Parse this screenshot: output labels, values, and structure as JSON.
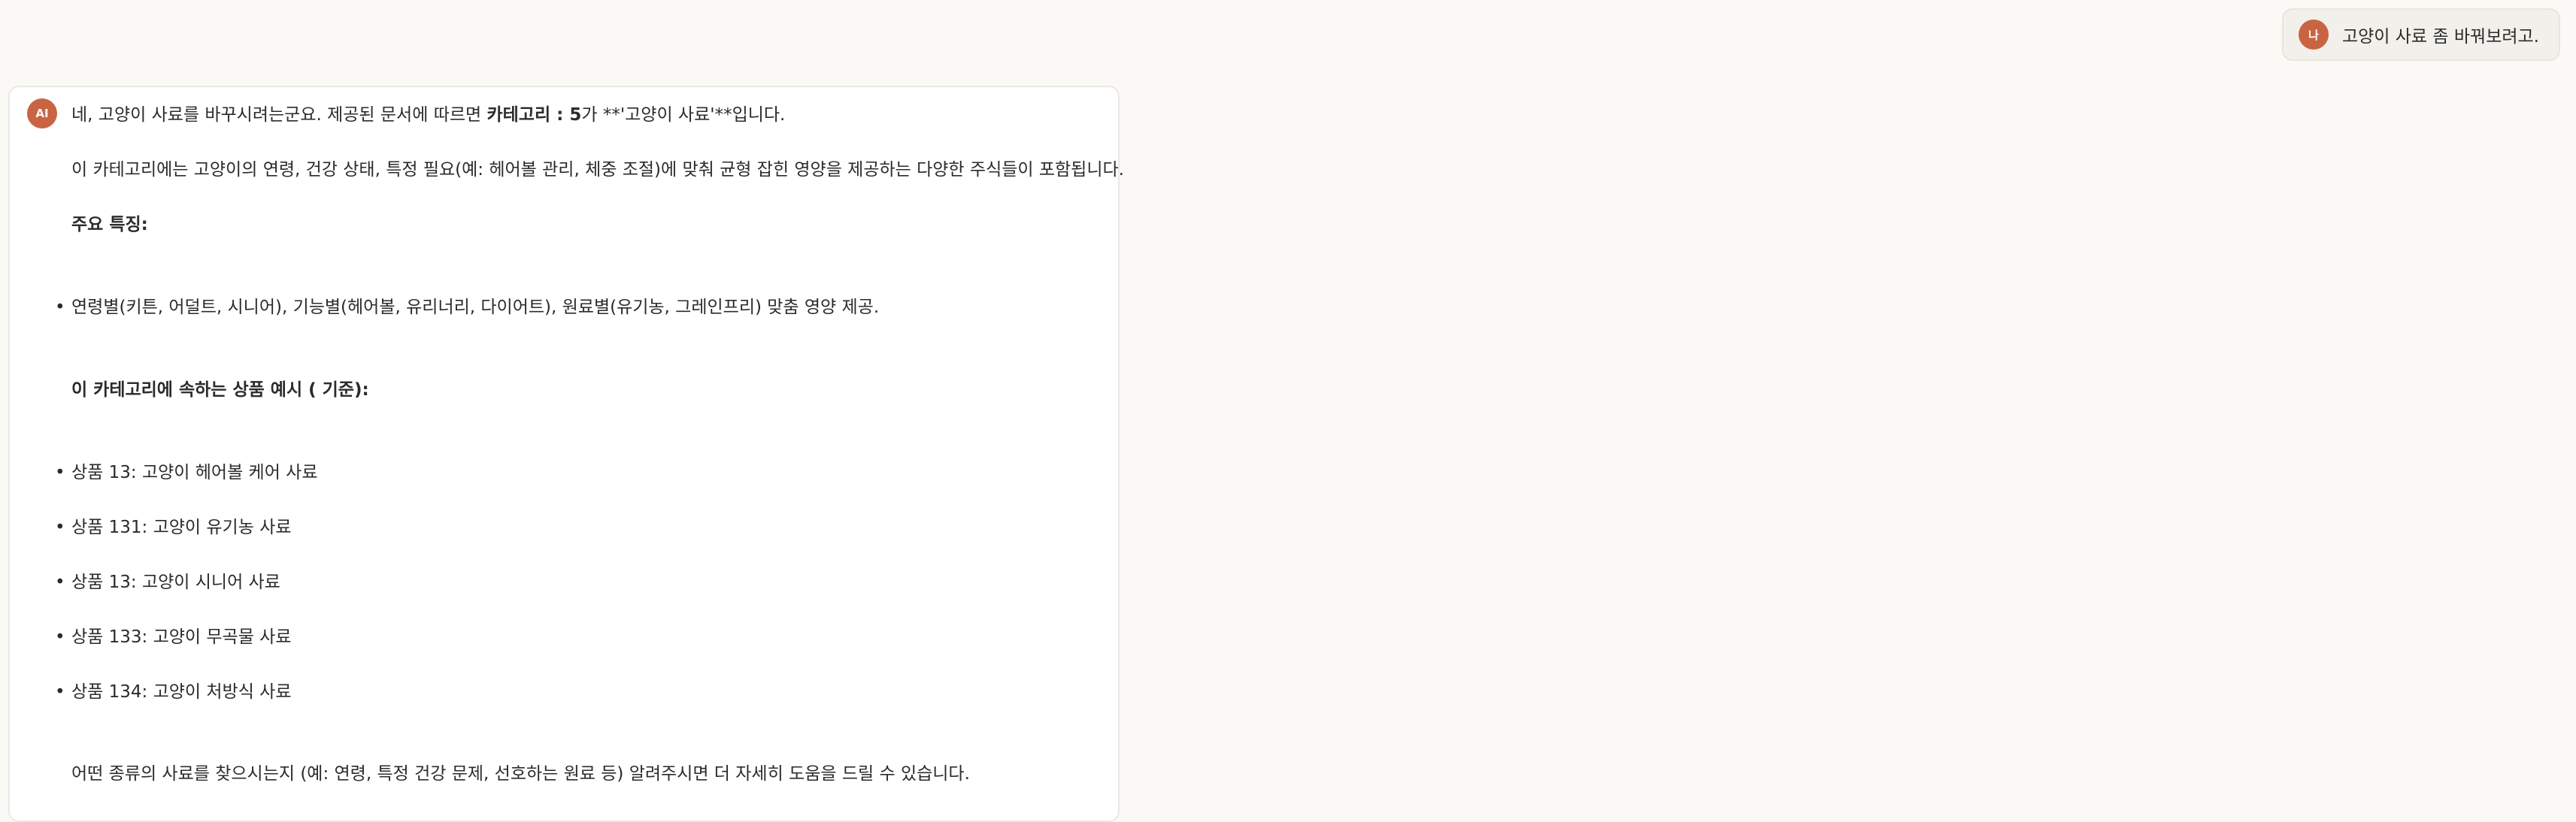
{
  "user_message": {
    "avatar_initial": "나",
    "text": "고양이 사료 좀 바꿔보려고."
  },
  "ai_message": {
    "avatar_label": "AI",
    "intro_prefix": "네, 고양이 사료를 바꾸시려는군요. 제공된 문서에 따르면 ",
    "intro_bold": "카테고리 : 5",
    "intro_suffix": "가 **'고양이 사료'**입니다.",
    "description": "이 카테고리에는 고양이의 연령, 건강 상태, 특정 필요(예: 헤어볼 관리, 체중 조절)에 맞춰 균형 잡힌 영양을 제공하는 다양한 주식들이 포함됩니다.",
    "features_heading": "주요 특징:",
    "features": [
      "연령별(키튼, 어덜트, 시니어), 기능별(헤어볼, 유리너리, 다이어트), 원료별(유기농, 그레인프리) 맞춤 영양 제공."
    ],
    "examples_heading": "이 카테고리에 속하는 상품 예시 ( 기준):",
    "examples": [
      "상품  13: 고양이 헤어볼 케어 사료",
      "상품  131: 고양이 유기농 사료",
      "상품  13: 고양이 시니어 사료",
      "상품  133: 고양이 무곡물 사료",
      "상품  134: 고양이 처방식 사료"
    ],
    "closing": "어떤 종류의 사료를 찾으시는지 (예: 연령, 특정 건강 문제, 선호하는 원료 등) 알려주시면 더 자세히 도움을 드릴 수 있습니다."
  }
}
